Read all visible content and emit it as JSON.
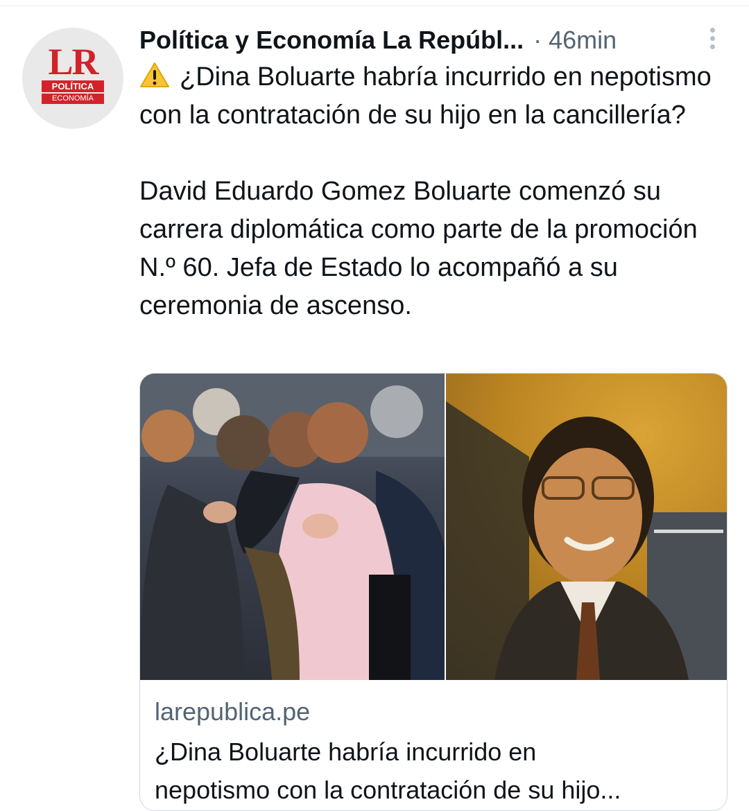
{
  "tweet": {
    "author": "Política y Economía La Repúbl...",
    "separator": "·",
    "time": "46min",
    "avatar": {
      "logo_text": "LR",
      "tag_top": "POLÍTICA",
      "tag_bottom": "ECONOMÍA"
    },
    "text": {
      "warning_icon": "warning-icon",
      "paragraph1": "¿Dina Boluarte habría incurrido en nepotismo con la contratación de su hijo en la cancillería?",
      "paragraph2": "David Eduardo Gomez Boluarte comenzó su carrera diplomática como parte de la promoción N.º 60. Jefa de Estado lo acompañó a su ceremonia de ascenso."
    }
  },
  "card": {
    "domain": "larepublica.pe",
    "title_line1": "¿Dina Boluarte habría incurrido en",
    "title_line2": "nepotismo con la contratación de su hijo..."
  },
  "colors": {
    "brand_red": "#d2232a",
    "secondary_text": "#536471",
    "border": "#cfd9de"
  }
}
